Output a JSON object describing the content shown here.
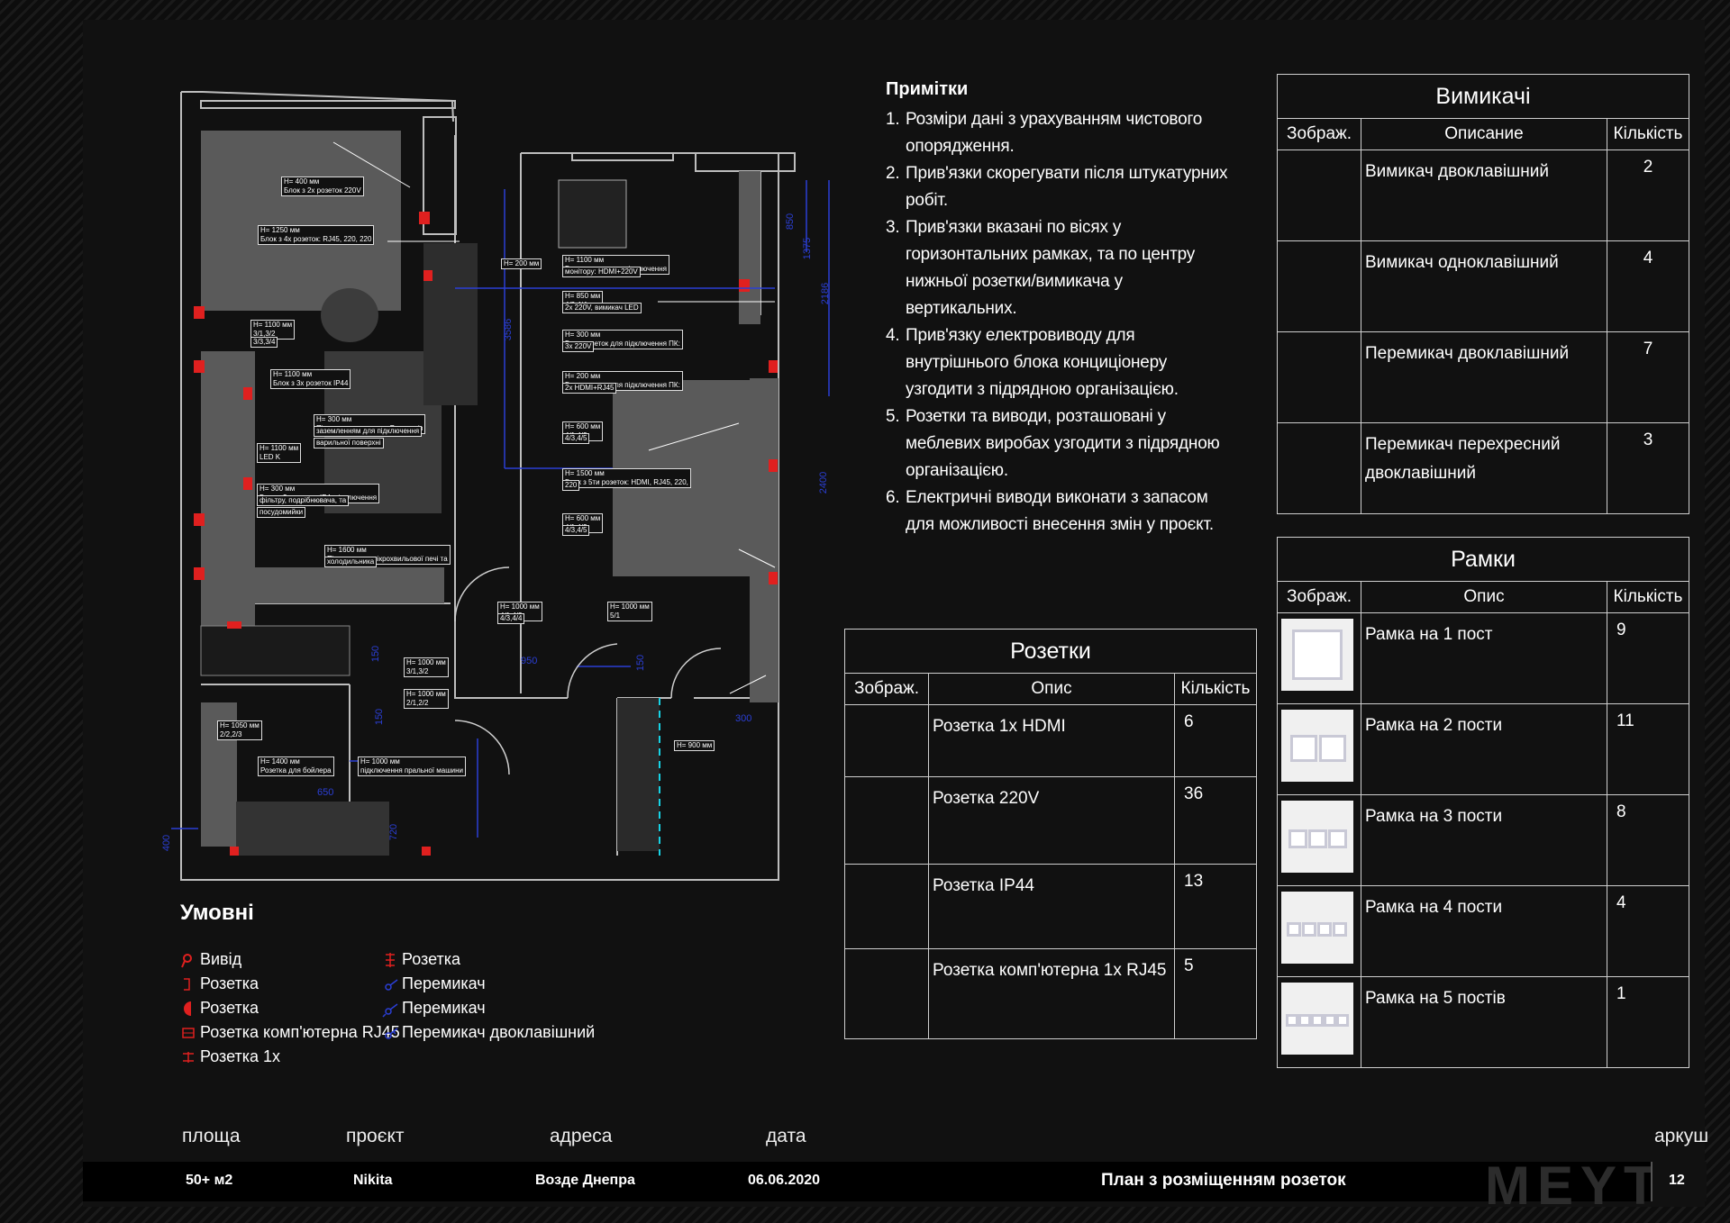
{
  "notes": {
    "title": "Примітки",
    "items": [
      {
        "n": "1.",
        "text": "Розміри дані з урахуванням чистового опорядження."
      },
      {
        "n": "2.",
        "text": "Прив'язки скорегувати після штукатурних робіт."
      },
      {
        "n": "3.",
        "text": "Прив'язки вказані по вісях у горизонтальних рамках, та по центру нижньої розетки/вимикача у вертикальних."
      },
      {
        "n": "4.",
        "text": "Прив'язку електровиводу для внутрішнього блока конциціонеру узгодити з підрядною організацією."
      },
      {
        "n": "5.",
        "text": "Розетки та виводи, розташовані у меблевих виробах узгодити з підрядною організацією."
      },
      {
        "n": "6.",
        "text": "Електричні виводи виконати з запасом для можливості внесення змін у проєкт."
      }
    ]
  },
  "switches": {
    "title": "Вимикачі",
    "headers": [
      "Зображ.",
      "Описание",
      "Кількість"
    ],
    "rows": [
      {
        "desc": "Вимикач двоклавішний",
        "qty": "2"
      },
      {
        "desc": "Вимикач одноклавішний",
        "qty": "4"
      },
      {
        "desc": "Перемикач двоклавішний",
        "qty": "7"
      },
      {
        "desc": "Перемикач перехресний двоклавішний",
        "qty": "3"
      }
    ]
  },
  "frames": {
    "title": "Рамки",
    "headers": [
      "Зображ.",
      "Опис",
      "Кількість"
    ],
    "rows": [
      {
        "desc": "Рамка на 1 пост",
        "qty": "9",
        "slots": 1
      },
      {
        "desc": "Рамка на 2 пости",
        "qty": "11",
        "slots": 2
      },
      {
        "desc": "Рамка на 3 пости",
        "qty": "8",
        "slots": 3
      },
      {
        "desc": "Рамка на 4 пости",
        "qty": "4",
        "slots": 4
      },
      {
        "desc": "Рамка на 5 постів",
        "qty": "1",
        "slots": 5
      }
    ]
  },
  "sockets": {
    "title": "Розетки",
    "headers": [
      "Зображ.",
      "Опис",
      "Кількість"
    ],
    "rows": [
      {
        "desc": "Розетка 1х HDMI",
        "qty": "6"
      },
      {
        "desc": "Розетка 220V",
        "qty": "36"
      },
      {
        "desc": "Розетка IP44",
        "qty": "13"
      },
      {
        "desc": "Розетка комп'ютерна 1х RJ45",
        "qty": "5"
      }
    ]
  },
  "legend": {
    "title": "Умовні",
    "items_left": [
      "Вивід",
      "Розетка",
      "Розетка",
      "Розетка комп'ютерна RJ45",
      "Розетка 1х"
    ],
    "items_right": [
      "Розетка",
      "Перемикач",
      "Перемикач",
      "Перемикач двоклавішний"
    ]
  },
  "plan_labels": [
    {
      "t1": "H= 400 мм",
      "t2": "Блок з 2х розеток 220V"
    },
    {
      "t1": "H= 1250 мм",
      "t2": "Блок з 4х розеток: RJ45, 220, 220"
    },
    {
      "t1": "H= 1100 мм",
      "t2": "3/1,3/2"
    },
    {
      "t1": "",
      "t2": "3/3,3/4"
    },
    {
      "t1": "H= 1100 мм",
      "t2": "Блок з 3х розеток IP44"
    },
    {
      "t1": "H= 300 мм",
      "t2": "Підключення духовки,Розетка із"
    },
    {
      "t1": "",
      "t2": "заземленням для підключення"
    },
    {
      "t1": "",
      "t2": "варильної поверхні"
    },
    {
      "t1": "H= 1100 мм",
      "t2": "LED K"
    },
    {
      "t1": "H= 300 мм",
      "t2": "Блок з 3х розеток IP4. підключення"
    },
    {
      "t1": "",
      "t2": "фільтру, подрібнювача, та"
    },
    {
      "t1": "",
      "t2": "посудомийки"
    },
    {
      "t1": "H= 1600 мм",
      "t2": "Підключення мікрохвильової печі та"
    },
    {
      "t1": "",
      "t2": "холодильника"
    },
    {
      "t1": "H= 200 мм",
      "t2": ""
    },
    {
      "t1": "H= 1100 мм",
      "t2": "Блок розеток для підключення"
    },
    {
      "t1": "",
      "t2": "монітору: HDMI+220V"
    },
    {
      "t1": "H= 850 мм",
      "t2": "4/3,4/4"
    },
    {
      "t1": "",
      "t2": "2х 220V, вимикач LED"
    },
    {
      "t1": "H= 300 мм",
      "t2": "Блок розеток для підключення ПК:"
    },
    {
      "t1": "",
      "t2": "3х 220V"
    },
    {
      "t1": "H= 200 мм",
      "t2": "Блок розеток для підключення ПК:"
    },
    {
      "t1": "",
      "t2": "2х HDMI+RJ45"
    },
    {
      "t1": "H= 600 мм",
      "t2": "4/1,4/2"
    },
    {
      "t1": "",
      "t2": "4/3,4/5"
    },
    {
      "t1": "H= 1500 мм",
      "t2": "Блок з 5ти розеток: HDMI, RJ45, 220,"
    },
    {
      "t1": "",
      "t2": "220"
    },
    {
      "t1": "H= 600 мм",
      "t2": "4/1,4/2"
    },
    {
      "t1": "",
      "t2": "4/3,4/5"
    },
    {
      "t1": "H= 1000 мм",
      "t2": "4/1,4/2"
    },
    {
      "t1": "",
      "t2": "4/3,4/4"
    },
    {
      "t1": "H= 1000 мм",
      "t2": "5/1"
    },
    {
      "t1": "H= 1000 мм",
      "t2": "3/1,3/2"
    },
    {
      "t1": "H= 1000 мм",
      "t2": "2/1,2/2"
    },
    {
      "t1": "H= 1050 мм",
      "t2": "2/2,2/3"
    },
    {
      "t1": "H= 1400 мм",
      "t2": "Розетка для бойлера"
    },
    {
      "t1": "H= 1000 мм",
      "t2": "підключення пральної машини"
    },
    {
      "t1": "H= 900 мм",
      "t2": ""
    }
  ],
  "dimensions": [
    "850",
    "1375",
    "2186",
    "3586",
    "2400",
    "950",
    "150",
    "650",
    "720",
    "400",
    "300",
    "150",
    "150"
  ],
  "title_block": {
    "labels": {
      "area": "площа",
      "project": "проєкт",
      "address": "адреса",
      "date": "дата",
      "sheet": "аркуш"
    },
    "values": {
      "area": "50+ м2",
      "project": "Nikita",
      "address": "Возде Днепра",
      "date": "06.06.2020",
      "sheet_title": "План з розміщенням розеток",
      "sheet": "12"
    },
    "logo": "MEYT"
  },
  "colors": {
    "accent": "#e0201f",
    "blue": "#2b3fd6",
    "cyan": "#16d3e6",
    "furniture": "#5a5a5a",
    "background": "#111111"
  }
}
